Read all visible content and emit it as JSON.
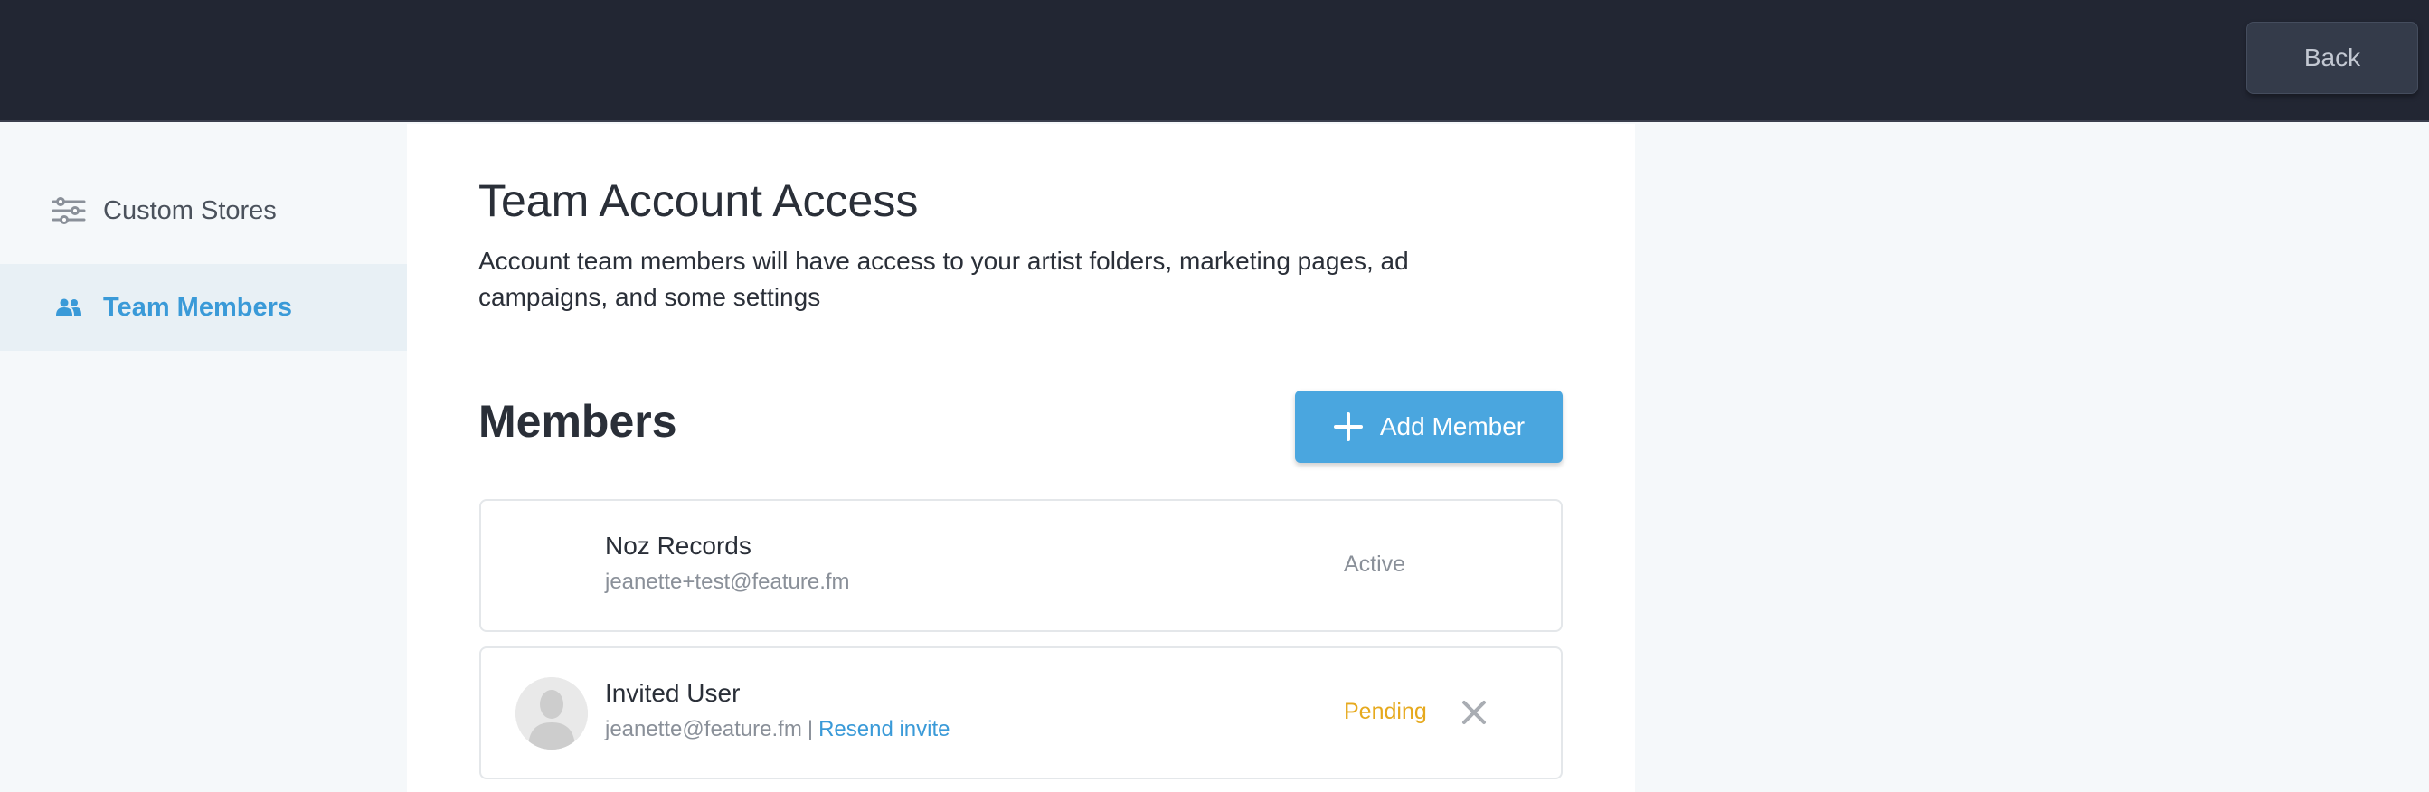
{
  "topbar": {
    "back_label": "Back"
  },
  "sidebar": {
    "items": [
      {
        "label": "Custom Stores",
        "icon": "sliders-icon"
      },
      {
        "label": "Team Members",
        "icon": "people-icon",
        "active": true
      }
    ]
  },
  "main": {
    "title": "Team Account Access",
    "description": "Account team members will have access to your artist folders, marketing pages, ad campaigns, and some settings",
    "members_title": "Members",
    "add_member_label": "Add Member",
    "members": [
      {
        "name": "Noz Records",
        "email": "jeanette+test@feature.fm",
        "status": "Active"
      },
      {
        "name": "Invited User",
        "email": "jeanette@feature.fm",
        "separator": "|",
        "resend_label": "Resend invite",
        "status": "Pending"
      }
    ]
  },
  "colors": {
    "topbar": "#222633",
    "accent": "#4aa6df",
    "pending": "#e6a91d",
    "active_sidebar_bg": "#e8f0f5"
  }
}
